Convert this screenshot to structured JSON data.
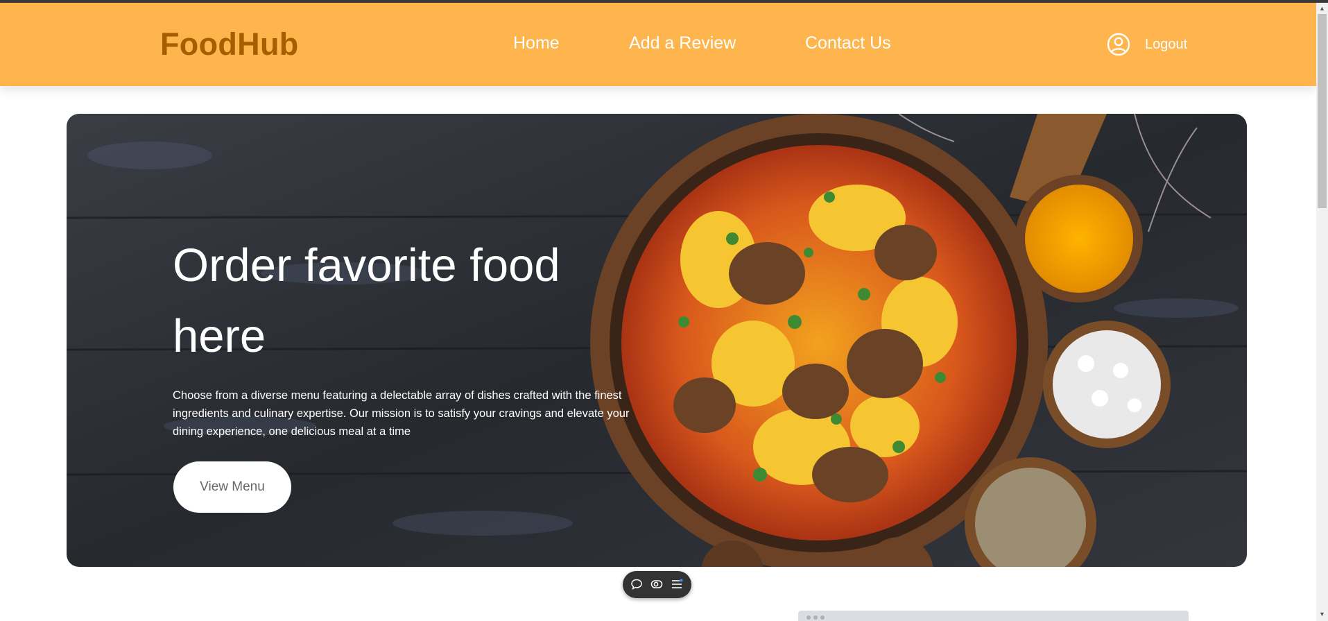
{
  "header": {
    "logo": "FoodHub",
    "nav": [
      "Home",
      "Add a Review",
      "Contact Us"
    ],
    "logout_label": "Logout",
    "user_icon": "user-circle-icon"
  },
  "hero": {
    "title": "Order favorite food here",
    "description": "Choose from a diverse menu featuring a delectable array of dishes crafted with the finest ingredients and culinary expertise. Our mission is to satisfy your cravings and elevate your dining experience, one delicious meal at a time",
    "button_label": "View Menu",
    "image": "food-bowl-photo"
  },
  "toolbar": {
    "icons": [
      "comment-icon",
      "eye-toggle-icon",
      "menu-list-icon"
    ]
  },
  "colors": {
    "header_bg": "#ffb54d",
    "logo": "#a65f00",
    "hero_bg": "#2b2e33",
    "button_text": "#666666"
  }
}
